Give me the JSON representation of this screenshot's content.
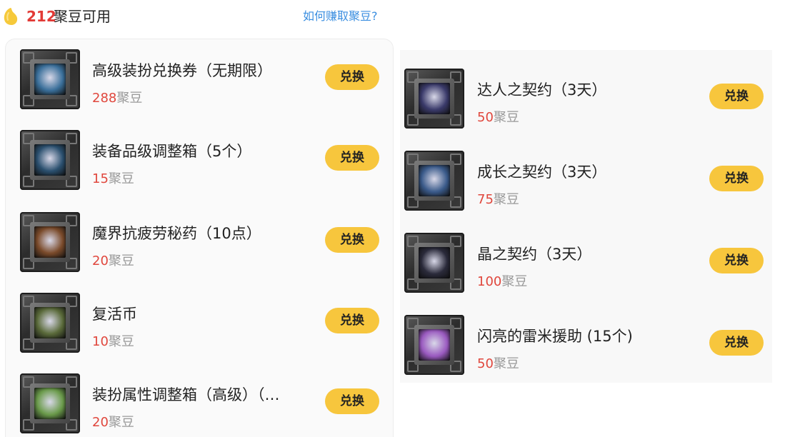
{
  "header": {
    "bean_count": "212",
    "bean_label": "聚豆可用",
    "earn_link": "如何赚取聚豆?"
  },
  "left_items": [
    {
      "name": "高级装扮兑换券（无期限）",
      "price": "288",
      "unit": "聚豆",
      "button": "兑换",
      "core_color": "#3a6f9a"
    },
    {
      "name": "装备品级调整箱（5个）",
      "price": "15",
      "unit": "聚豆",
      "button": "兑换",
      "core_color": "#2a4f6e"
    },
    {
      "name": "魔界抗疲劳秘药（10点）",
      "price": "20",
      "unit": "聚豆",
      "button": "兑换",
      "core_color": "#7a4a2a"
    },
    {
      "name": "复活币",
      "price": "10",
      "unit": "聚豆",
      "button": "兑换",
      "core_color": "#5a6a3a"
    },
    {
      "name": "装扮属性调整箱（高级）（…",
      "price": "20",
      "unit": "聚豆",
      "button": "兑换",
      "core_color": "#6a9a4a"
    }
  ],
  "right_items": [
    {
      "name": "达人之契约（3天）",
      "price": "50",
      "unit": "聚豆",
      "button": "兑换",
      "core_color": "#3a3a6a"
    },
    {
      "name": "成长之契约（3天）",
      "price": "75",
      "unit": "聚豆",
      "button": "兑换",
      "core_color": "#3a5a8a"
    },
    {
      "name": "晶之契约（3天）",
      "price": "100",
      "unit": "聚豆",
      "button": "兑换",
      "core_color": "#2a2a3a"
    },
    {
      "name": "闪亮的雷米援助 (15个)",
      "price": "50",
      "unit": "聚豆",
      "button": "兑换",
      "core_color": "#9a5ac0"
    }
  ],
  "colors": {
    "accent_button": "#f7c63d",
    "price": "#e0473d",
    "link": "#3a8ee0",
    "bean_count": "#e23a36"
  }
}
